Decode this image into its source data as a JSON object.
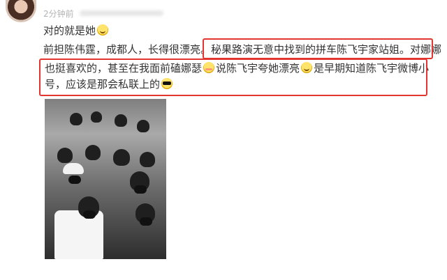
{
  "post": {
    "time": "2分钟前",
    "lines": {
      "l1": "对的就是她",
      "l2a": "前担陈伟霆，成都人，长得很漂亮。",
      "l2b": "秘果路演无意中找到的拼车陈飞宇家站姐。对娜娜",
      "l3a": "也挺喜欢的，甚至在我面前磕娜瑟",
      "l3b": "说陈飞宇夸她漂亮",
      "l3c": "是早期知道陈飞宇微博小",
      "l4": "号，应该是那会私联上的"
    }
  },
  "icons": {
    "emoji_1": "grin-emoji-icon",
    "emoji_2": "shy-emoji-icon",
    "emoji_3": "smile-emoji-icon",
    "emoji_4": "sunglasses-emoji-icon"
  },
  "colors": {
    "highlight_border": "#e3352f",
    "time": "#b3b3b3"
  }
}
